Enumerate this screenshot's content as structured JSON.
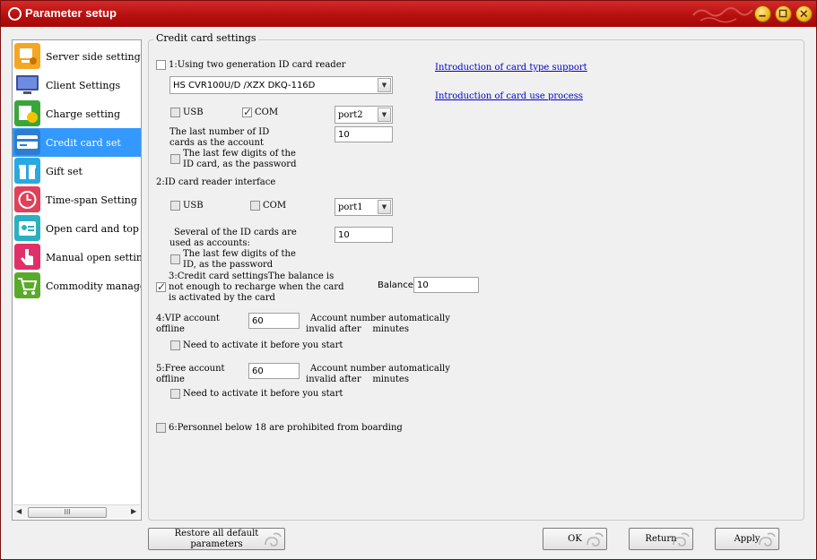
{
  "window": {
    "title": "Parameter setup"
  },
  "sidebar": {
    "items": [
      {
        "label": "Server side settings",
        "icon": "server-settings-icon",
        "color": "#f5a623"
      },
      {
        "label": "Client Settings",
        "icon": "monitor-icon",
        "color": "#3a4f9e"
      },
      {
        "label": "Charge setting",
        "icon": "charge-clock-icon",
        "color": "#3aa63a"
      },
      {
        "label": "Credit card set",
        "icon": "credit-card-icon",
        "color": "#2a7fd0"
      },
      {
        "label": "Gift set",
        "icon": "gift-icon",
        "color": "#2aa8e0"
      },
      {
        "label": "Time-span Setting",
        "icon": "clock-icon",
        "color": "#e0405a"
      },
      {
        "label": "Open card and top up",
        "icon": "open-card-icon",
        "color": "#2ab0c0"
      },
      {
        "label": "Manual open settings",
        "icon": "hand-pointer-icon",
        "color": "#e0306a"
      },
      {
        "label": "Commodity management",
        "icon": "cart-icon",
        "color": "#5aaa2a"
      }
    ],
    "selected_index": 3,
    "scroll_thumb": "III"
  },
  "section": {
    "legend": "Credit card settings",
    "opt1": {
      "label": "1:Using two generation ID card reader",
      "checked": false,
      "reader_model": "HS CVR100U/D /XZX DKQ-116D",
      "usb_label": "USB",
      "usb_checked": false,
      "com_label": "COM",
      "com_checked": true,
      "port": "port2",
      "last_number_label": "The last number of ID cards as the account",
      "last_number_line1": "The last number of ID",
      "last_number_line2": "cards as the account",
      "last_number_value": "10",
      "pwd_line1": "The last few digits of the",
      "pwd_line2": "ID card, as the password",
      "pwd_checked": false
    },
    "links": {
      "card_type": "Introduction of card type support",
      "card_use": "Introduction of card use process"
    },
    "opt2": {
      "label": "2:ID card reader interface",
      "usb_label": "USB",
      "usb_checked": false,
      "com_label": "COM",
      "com_checked": false,
      "port": "port1",
      "accounts_line1": "Several of the ID cards are",
      "accounts_line2": "used as accounts:",
      "accounts_value": "10",
      "pwd_line1": "The last few digits of the",
      "pwd_line2": "ID, as the password",
      "pwd_checked": false
    },
    "opt3": {
      "line1": "3:Credit card settingsThe balance is",
      "line2": "not enough to recharge when the card",
      "line3": "is activated by the card",
      "checked": true,
      "balance_label": "Balance",
      "balance_value": "10"
    },
    "opt4": {
      "line1": "4:VIP account",
      "line2": "offline",
      "value": "60",
      "desc_line1": "Account number automatically",
      "desc_line2": "invalid after    minutes",
      "activate_label": "Need to activate it before you start",
      "activate_checked": false
    },
    "opt5": {
      "line1": "5:Free account",
      "line2": "offline",
      "value": "60",
      "desc_line1": "Account number automatically",
      "desc_line2": "invalid after    minutes",
      "activate_label": "Need to activate it before you start",
      "activate_checked": false
    },
    "opt6": {
      "label": "6:Personnel below 18 are prohibited from boarding",
      "checked": false
    }
  },
  "buttons": {
    "restore_line1": "Restore all default",
    "restore_line2": "parameters",
    "ok": "OK",
    "return": "Return",
    "apply": "Apply"
  },
  "colors": {
    "titlebar": "#b70f0f",
    "selection": "#3399ff",
    "link": "#0000cc"
  }
}
